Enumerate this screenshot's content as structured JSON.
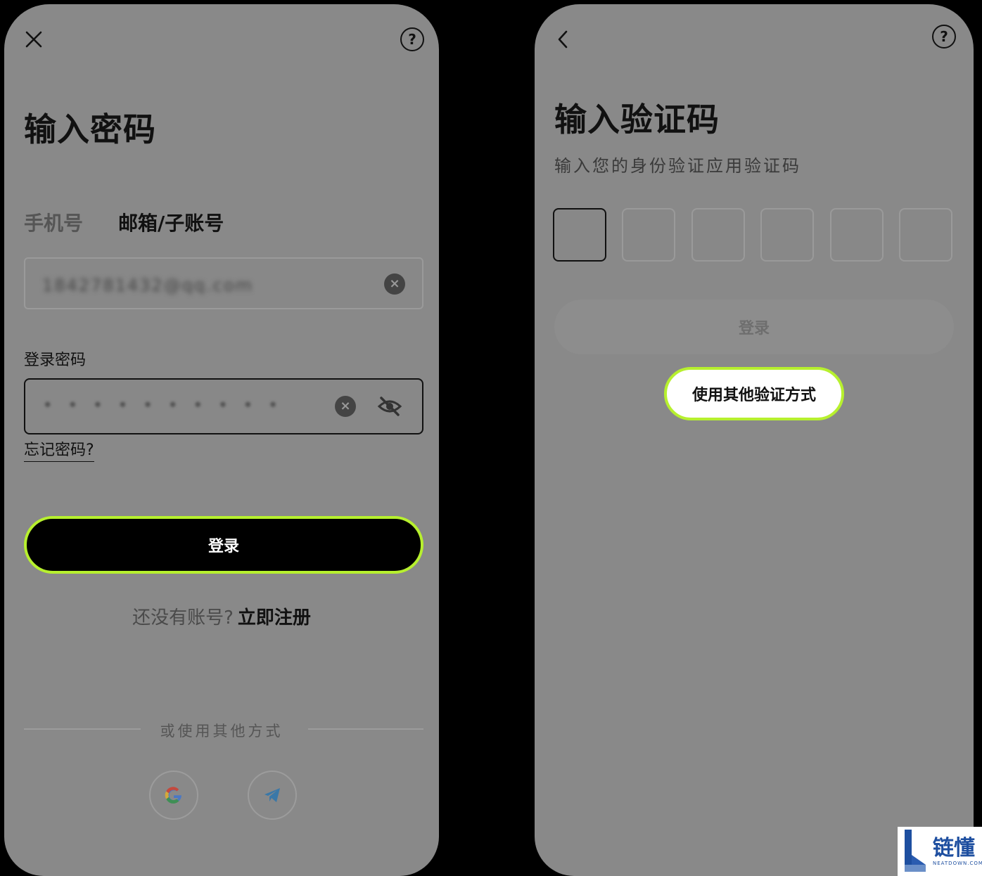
{
  "left_screen": {
    "title": "输入密码",
    "tabs": [
      {
        "label": "手机号",
        "active": false
      },
      {
        "label": "邮箱/子账号",
        "active": true
      }
    ],
    "account_input": {
      "value": "1842781432@qq.com"
    },
    "password_label": "登录密码",
    "password_input": {
      "value": "• • •  •  •  • • • •  •"
    },
    "forgot_link": "忘记密码?",
    "login_button": "登录",
    "register_prompt": "还没有账号?",
    "register_link": "立即注册",
    "divider_text": "或使用其他方式",
    "social": [
      {
        "name": "google-icon"
      },
      {
        "name": "telegram-icon"
      }
    ]
  },
  "right_screen": {
    "title": "输入验证码",
    "subtitle": "输入您的身份验证应用验证码",
    "code_boxes": 6,
    "login_button": "登录",
    "other_method_button": "使用其他验证方式"
  },
  "watermark": {
    "cn": "链懂",
    "en": "NEATDOWN.COM"
  },
  "colors": {
    "accent": "#b7f02e",
    "overlay": "#898989",
    "primary": "#000000"
  }
}
